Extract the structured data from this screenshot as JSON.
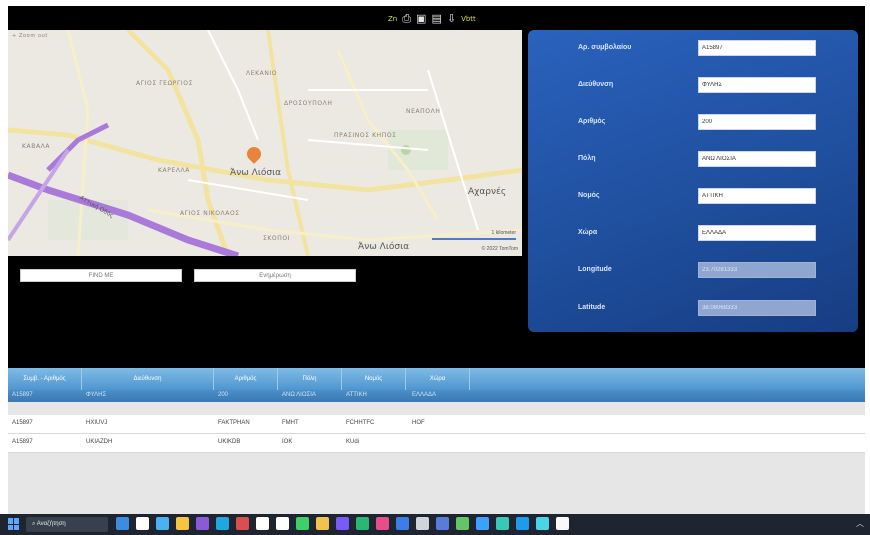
{
  "toolbar": {
    "zoom_text": "Zn",
    "extra_text": "Vbtt",
    "icons": [
      "print-icon",
      "save-icon",
      "form-icon",
      "export-icon"
    ]
  },
  "map": {
    "labels": {
      "agios_georgios": "ΑΓΙΟΣ ΓΕΩΡΓΙΟΣ",
      "lekanio": "ΛΕΚΑΝΙΟ",
      "drosoupoli": "ΔΡΟΣΟΥΠΟΛΗ",
      "neapoli": "ΝΕΑΠΟΛΗ",
      "ano_liosia": "Άνω Λιόσια",
      "kavala": "ΚΑΒΑΛΑ",
      "karella": "ΚΑΡΕΛΛΑ",
      "agios_nikolaos": "ΑΓΙΟΣ ΝΙΚΟΛΑΟΣ",
      "prasinos_kipos": "ΠΡΑΣΙΝΟΣ ΚΗΠΟΣ",
      "acharnes": "Αχαρνές",
      "attiki_odos": "Αττική Οδός",
      "ano_bottom": "Άνω Λιόσια",
      "dimou": "ΣΚΟΠΟΙ",
      "zoom_ctrl": "+ Zoom out"
    },
    "scale": "1 kilometer",
    "attribution": "© 2022 TomTom"
  },
  "buttons": {
    "find": "FIND ME",
    "update": "Ενημέρωση"
  },
  "form": {
    "fields": [
      {
        "label": "Αρ. συμβολαίου",
        "value": "A15897",
        "readonly": false
      },
      {
        "label": "Διεύθυνση",
        "value": "ΦΥΛΗΣ",
        "readonly": false
      },
      {
        "label": "Αριθμός",
        "value": "200",
        "readonly": false
      },
      {
        "label": "Πόλη",
        "value": "ΑΝΩ ΛΙΟΣΙΑ",
        "readonly": false
      },
      {
        "label": "Νομός",
        "value": "ΑΤΤΙΚΗ",
        "readonly": false
      },
      {
        "label": "Χώρα",
        "value": "ΕΛΛΑΔΑ",
        "readonly": false
      },
      {
        "label": "Longitude",
        "value": "23.70281333",
        "readonly": true
      },
      {
        "label": "Latitude",
        "value": "38.08068333",
        "readonly": true
      }
    ]
  },
  "grid": {
    "columns": [
      "Συμβ. - Αριθμός",
      "Διεύθυνση",
      "Αριθμός",
      "Πόλη",
      "Νομός",
      "Χώρα"
    ],
    "filter_row": [
      "A15897",
      "ΦΥΛΗΣ",
      "200",
      "ΑΝΩ ΛΙΟΣΙΑ",
      "ΑΤΤΙΚΗ",
      "ΕΛΛΑΔΑ"
    ],
    "rows": [
      [
        "A15897",
        "HXIUVJ",
        "FAKTPHAN",
        "FMHT",
        "FCHHTFC",
        "HOF"
      ],
      [
        "A15897",
        "UKIAZDH",
        "UKIKDB",
        "IOK",
        "KUdi",
        ""
      ]
    ]
  },
  "taskbar": {
    "search_text": "Αναζήτηση",
    "icon_colors": [
      "#3c8de0",
      "#ffffff",
      "#4bb1f4",
      "#f5c542",
      "#8a5bd6",
      "#1fa8e0",
      "#d94f4f",
      "#ffffff",
      "#ffffff",
      "#3ecf6a",
      "#f2c14e",
      "#7a5af8",
      "#2bb673",
      "#e84d8a",
      "#3d7de6",
      "#cfd4da",
      "#5b7bd9",
      "#64c466",
      "#3ea1ff",
      "#37c9b6",
      "#1c9cea",
      "#4bd3e8",
      "#f9f9f9"
    ]
  }
}
